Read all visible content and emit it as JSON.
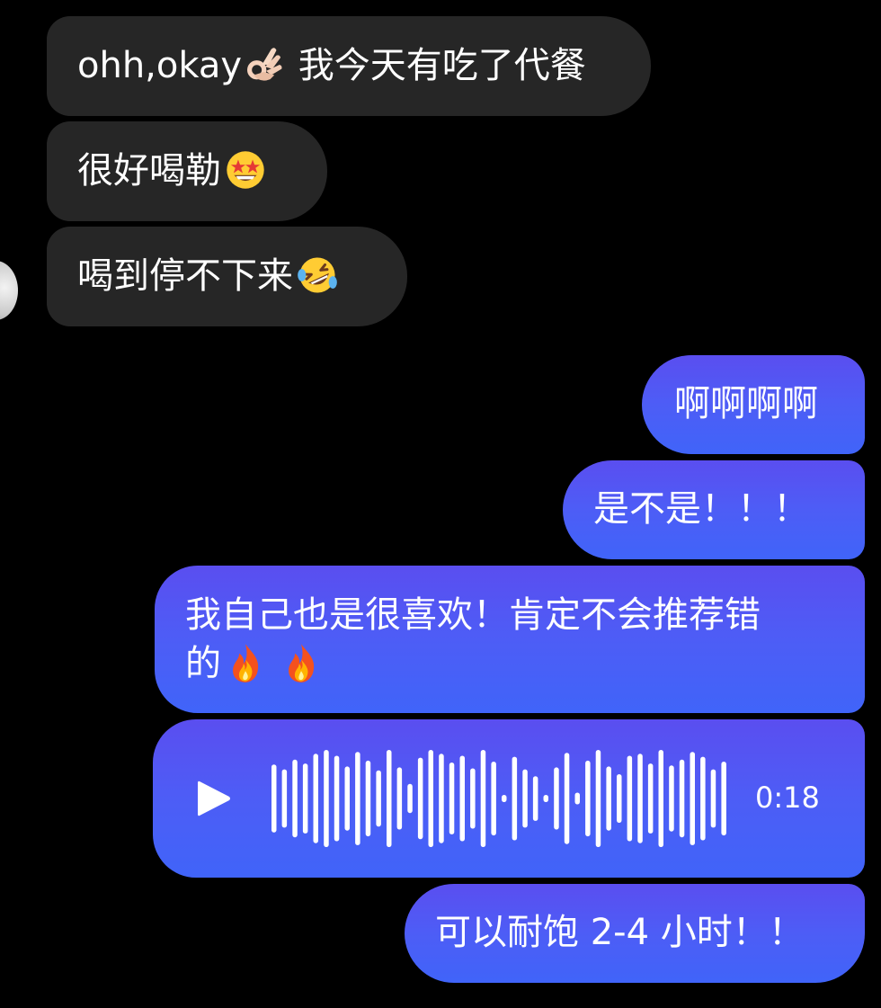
{
  "incoming": [
    {
      "text": "ohh,okay",
      "emoji": "ok-hand",
      "suffix": " 我今天有吃了代餐"
    },
    {
      "text": "很好喝勒",
      "emoji": "star-struck"
    },
    {
      "text": "喝到停不下来",
      "emoji": "rofl"
    }
  ],
  "outgoing": [
    {
      "text": "啊啊啊啊"
    },
    {
      "text": "是不是！！！"
    },
    {
      "line1": "我自己也是很喜欢！肯定不会推荐错",
      "line2": "的",
      "emoji": "fire"
    },
    {
      "type": "voice",
      "duration": "0:18",
      "icon": "play-icon"
    },
    {
      "text": "可以耐饱 2-4 小时！！"
    }
  ],
  "colors": {
    "background": "#000000",
    "incoming_bubble": "#262626",
    "outgoing_bubble_top": "#5a4ef0",
    "outgoing_bubble_bottom": "#4064f9",
    "text": "#ffffff"
  }
}
